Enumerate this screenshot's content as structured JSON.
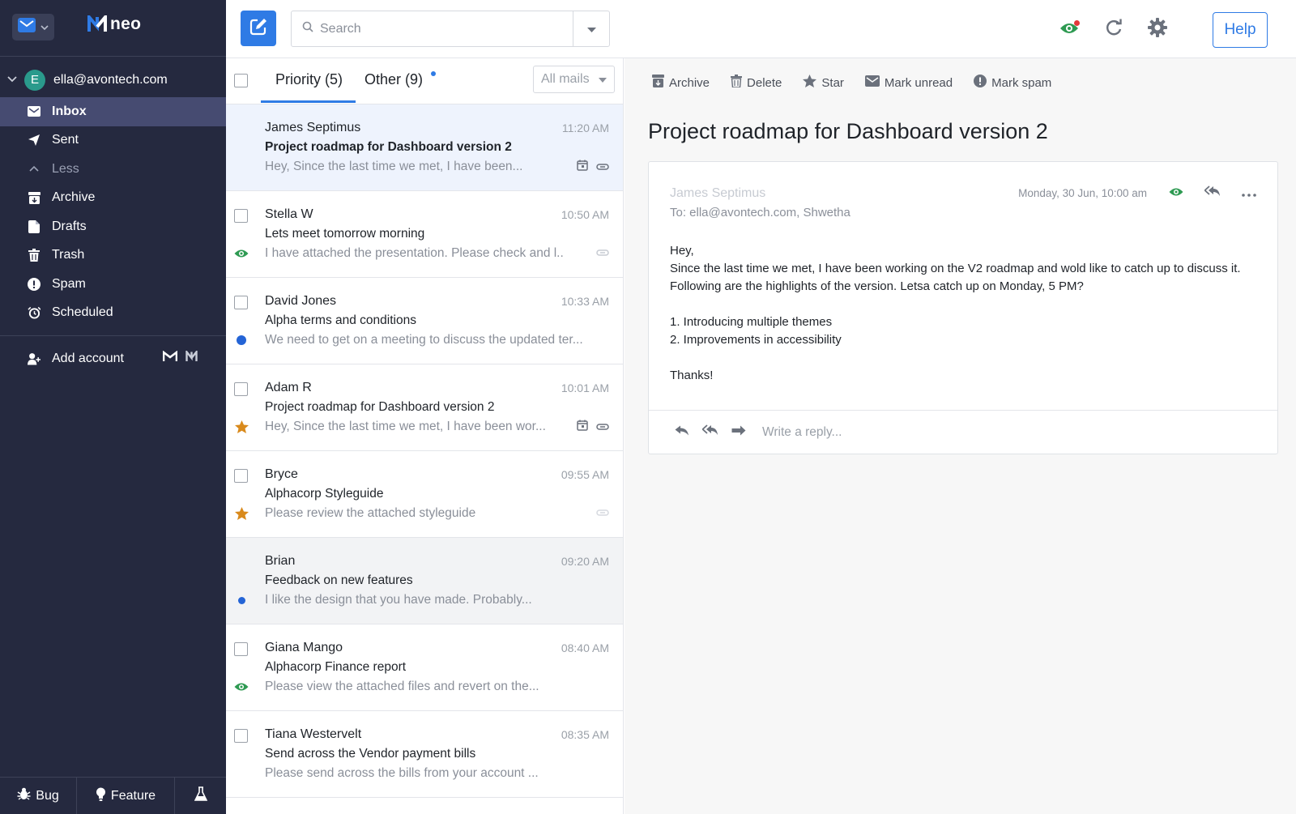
{
  "app": {
    "logo_text": "neo"
  },
  "account": {
    "avatar_letter": "E",
    "email": "ella@avontech.com"
  },
  "nav": [
    {
      "label": "Inbox",
      "icon": "envelope-icon"
    },
    {
      "label": "Sent",
      "icon": "paper-plane-icon"
    },
    {
      "label": "Less",
      "icon": "chevron-up-icon"
    },
    {
      "label": "Archive",
      "icon": "archive-icon"
    },
    {
      "label": "Drafts",
      "icon": "draft-icon"
    },
    {
      "label": "Trash",
      "icon": "trash-icon"
    },
    {
      "label": "Spam",
      "icon": "exclamation-icon"
    },
    {
      "label": "Scheduled",
      "icon": "clock-icon"
    }
  ],
  "add_account": {
    "label": "Add account"
  },
  "footer": {
    "bug": "Bug",
    "feature": "Feature"
  },
  "search": {
    "placeholder": "Search"
  },
  "help": {
    "label": "Help"
  },
  "list": {
    "tab_priority": "Priority (5)",
    "tab_other": "Other (9)",
    "filter": "All mails"
  },
  "mails": [
    {
      "from": "James Septimus",
      "time": "11:20 AM",
      "subject": "Project roadmap for Dashboard version 2",
      "preview": "Hey, Since the last time we met, I have been..."
    },
    {
      "from": "Stella W",
      "time": "10:50 AM",
      "subject": "Lets meet tomorrow morning",
      "preview": "I have attached the presentation. Please check and l..."
    },
    {
      "from": "David Jones",
      "time": "10:33 AM",
      "subject": "Alpha terms and conditions",
      "preview": "We need to get on a meeting to discuss the updated ter..."
    },
    {
      "from": "Adam R",
      "time": "10:01 AM",
      "subject": "Project roadmap for Dashboard version 2",
      "preview": "Hey, Since the last time we met, I have been wor..."
    },
    {
      "from": "Bryce",
      "time": "09:55 AM",
      "subject": "Alphacorp Styleguide",
      "preview": "Please review the attached styleguide"
    },
    {
      "from": "Brian",
      "time": "09:20 AM",
      "subject": "Feedback on new features",
      "preview": "I like the design that you have made. Probably..."
    },
    {
      "from": "Giana Mango",
      "time": "08:40 AM",
      "subject": "Alphacorp Finance report",
      "preview": "Please view the attached files and revert on the..."
    },
    {
      "from": "Tiana Westervelt",
      "time": "08:35 AM",
      "subject": "Send across the Vendor payment bills",
      "preview": "Please send across the bills from your account ..."
    }
  ],
  "actions": {
    "archive": "Archive",
    "delete": "Delete",
    "star": "Star",
    "mark_unread": "Mark unread",
    "mark_spam": "Mark spam"
  },
  "reader": {
    "title": "Project roadmap for Dashboard version 2",
    "from": "James Septimus",
    "to": "To: ella@avontech.com, Shwetha",
    "date": "Monday, 30 Jun, 10:00 am",
    "body": [
      "Hey,",
      "Since the last time we met, I have been working on the V2 roadmap and wold like to catch up to discuss it. Following are the highlights of the version. Letsa catch up on Monday, 5 PM?",
      "",
      "1. Introducing multiple themes",
      "2. Improvements in accessibility",
      "",
      "Thanks!"
    ],
    "reply_placeholder": "Write a reply..."
  },
  "colors": {
    "sidebar": "#25293f",
    "accent": "#2f7be5",
    "star": "#d98a1c",
    "read_eye": "#2e9a52",
    "unread_dot": "#2464d6"
  }
}
